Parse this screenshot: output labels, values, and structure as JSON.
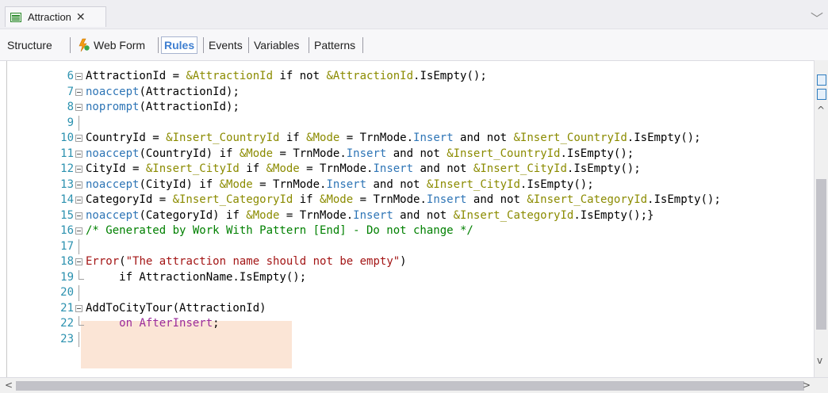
{
  "doc_tab": {
    "title": "Attraction",
    "close": "✕",
    "icon": "transaction-object-icon"
  },
  "tab_overflow": "﹀",
  "subtabs": [
    {
      "label": "Structure"
    },
    {
      "label": "Web Form",
      "icon": "web-form-icon"
    },
    {
      "label": "Rules",
      "active": true
    },
    {
      "label": "Events"
    },
    {
      "label": "Variables"
    },
    {
      "label": "Patterns"
    }
  ],
  "code_lines": [
    {
      "n": "6",
      "fold": "start",
      "segs": [
        [
          "t",
          "AttractionId = "
        ],
        [
          "v",
          "&AttractionId"
        ],
        [
          "t",
          " if not "
        ],
        [
          "v",
          "&AttractionId"
        ],
        [
          "t",
          ".IsEmpty();"
        ]
      ]
    },
    {
      "n": "7",
      "fold": "start",
      "segs": [
        [
          "b",
          "noaccept"
        ],
        [
          "t",
          "(AttractionId);"
        ]
      ]
    },
    {
      "n": "8",
      "fold": "start",
      "segs": [
        [
          "b",
          "noprompt"
        ],
        [
          "t",
          "(AttractionId);"
        ]
      ]
    },
    {
      "n": "9",
      "fold": "line",
      "segs": []
    },
    {
      "n": "10",
      "fold": "start",
      "segs": [
        [
          "t",
          "CountryId = "
        ],
        [
          "v",
          "&Insert_CountryId"
        ],
        [
          "t",
          " if "
        ],
        [
          "v",
          "&Mode"
        ],
        [
          "t",
          " = TrnMode."
        ],
        [
          "b",
          "Insert"
        ],
        [
          "t",
          " and not "
        ],
        [
          "v",
          "&Insert_CountryId"
        ],
        [
          "t",
          ".IsEmpty();"
        ]
      ]
    },
    {
      "n": "11",
      "fold": "start",
      "segs": [
        [
          "b",
          "noaccept"
        ],
        [
          "t",
          "(CountryId) if "
        ],
        [
          "v",
          "&Mode"
        ],
        [
          "t",
          " = TrnMode."
        ],
        [
          "b",
          "Insert"
        ],
        [
          "t",
          " and not "
        ],
        [
          "v",
          "&Insert_CountryId"
        ],
        [
          "t",
          ".IsEmpty();"
        ]
      ]
    },
    {
      "n": "12",
      "fold": "start",
      "segs": [
        [
          "t",
          "CityId = "
        ],
        [
          "v",
          "&Insert_CityId"
        ],
        [
          "t",
          " if "
        ],
        [
          "v",
          "&Mode"
        ],
        [
          "t",
          " = TrnMode."
        ],
        [
          "b",
          "Insert"
        ],
        [
          "t",
          " and not "
        ],
        [
          "v",
          "&Insert_CityId"
        ],
        [
          "t",
          ".IsEmpty();"
        ]
      ]
    },
    {
      "n": "13",
      "fold": "start",
      "segs": [
        [
          "b",
          "noaccept"
        ],
        [
          "t",
          "(CityId) if "
        ],
        [
          "v",
          "&Mode"
        ],
        [
          "t",
          " = TrnMode."
        ],
        [
          "b",
          "Insert"
        ],
        [
          "t",
          " and not "
        ],
        [
          "v",
          "&Insert_CityId"
        ],
        [
          "t",
          ".IsEmpty();"
        ]
      ]
    },
    {
      "n": "14",
      "fold": "start",
      "segs": [
        [
          "t",
          "CategoryId = "
        ],
        [
          "v",
          "&Insert_CategoryId"
        ],
        [
          "t",
          " if "
        ],
        [
          "v",
          "&Mode"
        ],
        [
          "t",
          " = TrnMode."
        ],
        [
          "b",
          "Insert"
        ],
        [
          "t",
          " and not "
        ],
        [
          "v",
          "&Insert_CategoryId"
        ],
        [
          "t",
          ".IsEmpty();"
        ]
      ]
    },
    {
      "n": "15",
      "fold": "start",
      "segs": [
        [
          "b",
          "noaccept"
        ],
        [
          "t",
          "(CategoryId) if "
        ],
        [
          "v",
          "&Mode"
        ],
        [
          "t",
          " = TrnMode."
        ],
        [
          "b",
          "Insert"
        ],
        [
          "t",
          " and not "
        ],
        [
          "v",
          "&Insert_CategoryId"
        ],
        [
          "t",
          ".IsEmpty();}"
        ]
      ]
    },
    {
      "n": "16",
      "fold": "start",
      "segs": [
        [
          "c",
          "/* Generated by Work With Pattern [End] - Do not change */"
        ]
      ]
    },
    {
      "n": "17",
      "fold": "line",
      "segs": []
    },
    {
      "n": "18",
      "fold": "start",
      "segs": [
        [
          "e",
          "Error"
        ],
        [
          "t",
          "("
        ],
        [
          "s",
          "\"The attraction name should not be empty\""
        ],
        [
          "t",
          ")"
        ]
      ]
    },
    {
      "n": "19",
      "fold": "end",
      "segs": [
        [
          "t",
          "     if AttractionName.IsEmpty();"
        ]
      ]
    },
    {
      "n": "20",
      "fold": "line",
      "segs": []
    },
    {
      "n": "21",
      "fold": "start",
      "segs": [
        [
          "t",
          "AddToCityTour(AttractionId)"
        ]
      ]
    },
    {
      "n": "22",
      "fold": "end",
      "segs": [
        [
          "t",
          "     "
        ],
        [
          "p",
          "on AfterInsert"
        ],
        [
          "t",
          ";"
        ]
      ]
    },
    {
      "n": "23",
      "fold": "line",
      "segs": []
    }
  ],
  "scrollbars": {
    "up": "^",
    "down": "v",
    "left": "<",
    "right": ">"
  }
}
